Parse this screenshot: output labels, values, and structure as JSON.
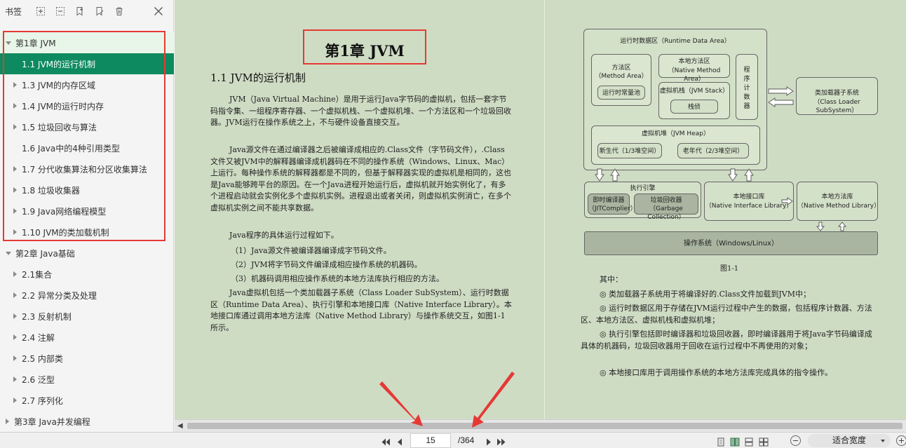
{
  "sidebar": {
    "title": "书签",
    "toolbar_icons": [
      "expand-all-icon",
      "collapse-all-icon",
      "add-bookmark-icon",
      "bookmark-edit-icon",
      "delete-icon"
    ],
    "items": [
      {
        "label": "第1章 JVM",
        "level": 0,
        "arrow": "down",
        "state": "chapter-active"
      },
      {
        "label": "1.1 JVM的运行机制",
        "level": 1,
        "arrow": "none",
        "state": "selected"
      },
      {
        "label": "1.3 JVM的内存区域",
        "level": 1,
        "arrow": "right",
        "state": ""
      },
      {
        "label": "1.4 JVM的运行时内存",
        "level": 1,
        "arrow": "right",
        "state": ""
      },
      {
        "label": "1.5 垃圾回收与算法",
        "level": 1,
        "arrow": "right",
        "state": ""
      },
      {
        "label": "1.6 Java中的4种引用类型",
        "level": 1,
        "arrow": "none",
        "state": ""
      },
      {
        "label": "1.7 分代收集算法和分区收集算法",
        "level": 1,
        "arrow": "right",
        "state": ""
      },
      {
        "label": "1.8 垃圾收集器",
        "level": 1,
        "arrow": "right",
        "state": ""
      },
      {
        "label": "1.9 Java网络编程模型",
        "level": 1,
        "arrow": "right",
        "state": ""
      },
      {
        "label": "1.10 JVM的类加载机制",
        "level": 1,
        "arrow": "right",
        "state": ""
      },
      {
        "label": "第2章 Java基础",
        "level": 0,
        "arrow": "down",
        "state": ""
      },
      {
        "label": "2.1集合",
        "level": 1,
        "arrow": "right",
        "state": ""
      },
      {
        "label": "2.2 异常分类及处理",
        "level": 1,
        "arrow": "right",
        "state": ""
      },
      {
        "label": "2.3 反射机制",
        "level": 1,
        "arrow": "right",
        "state": ""
      },
      {
        "label": "2.4 注解",
        "level": 1,
        "arrow": "right",
        "state": ""
      },
      {
        "label": "2.5 内部类",
        "level": 1,
        "arrow": "right",
        "state": ""
      },
      {
        "label": "2.6 泛型",
        "level": 1,
        "arrow": "right",
        "state": ""
      },
      {
        "label": "2.7 序列化",
        "level": 1,
        "arrow": "right",
        "state": ""
      },
      {
        "label": "第3章 Java并发编程",
        "level": 0,
        "arrow": "right",
        "state": ""
      }
    ]
  },
  "document": {
    "chapter_title": "第1章 JVM",
    "section_title": "1.1 JVM的运行机制",
    "p1": "JVM（Java Virtual Machine）是用于运行Java字节码的虚拟机，包括一套字节码指令集、一组程序寄存器、一个虚拟机栈、一个虚拟机堆、一个方法区和一个垃圾回收器。JVM运行在操作系统之上，不与硬件设备直接交互。",
    "p2": "Java源文件在通过编译器之后被编译成相应的.Class文件（字节码文件），.Class文件又被JVM中的解释器编译成机器码在不同的操作系统（Windows、Linux、Mac）上运行。每种操作系统的解释器都是不同的，但基于解释器实现的虚拟机是相同的，这也是Java能够跨平台的原因。在一个Java进程开始运行后，虚拟机就开始实例化了，有多个进程启动就会实例化多个虚拟机实例。进程退出或者关闭，则虚拟机实例消亡，在多个虚拟机实例之间不能共享数据。",
    "p3": "Java程序的具体运行过程如下。",
    "step1": "（1）Java源文件被编译器编译成字节码文件。",
    "step2": "（2）JVM将字节码文件编译成相应操作系统的机器码。",
    "step3": "（3）机器码调用相应操作系统的本地方法库执行相应的方法。",
    "p4": "Java虚拟机包括一个类加载器子系统（Class Loader SubSystem）、运行时数据区（Runtime Data Area）、执行引擎和本地接口库（Native Interface Library）。本地接口库通过调用本地方法库（Native Method Library）与操作系统交互，如图1-1所示。"
  },
  "diagram": {
    "runtime_area": "运行时数据区（Runtime Data Area）",
    "method_area": "方法区",
    "method_area_en": "（Method Area）",
    "const_pool": "运行时常量池",
    "native_stack": "本地方法区",
    "native_stack_en": "（Native Method Area）",
    "vm_stack": "虚拟机栈（JVM Stack）",
    "frame": "栈侦",
    "pc": [
      "程",
      "序",
      "计",
      "数",
      "器"
    ],
    "heap": "虚拟机堆（JVM Heap）",
    "young": "新生代（1/3堆空间）",
    "old": "老年代（2/3堆空间）",
    "class_loader": "类加载器子系统",
    "class_loader_en": "（Class Loader SubSystem）",
    "exec_engine": "执行引擎",
    "jit": "即时编译器",
    "jit_en": "（JITComplier）",
    "gc": "垃圾回收器",
    "gc_en": "（Garbage Collection）",
    "native_if": "本地接口库",
    "native_if_en": "（Native Interface Library）",
    "native_lib": "本地方法库",
    "native_lib_en": "（Native Method Library）",
    "os": "操作系统（Windows/Linux）",
    "caption": "图1-1"
  },
  "right_text": {
    "intro": "其中：",
    "b1": "◎  类加载器子系统用于将编译好的.Class文件加载到JVM中；",
    "b2": "◎  运行时数据区用于存储在JVM运行过程中产生的数据，包括程序计数器、方法区、本地方法区、虚拟机栈和虚拟机堆；",
    "b3": "◎  执行引擎包括即时编译器和垃圾回收器，即时编译器用于将Java字节码编译成具体的机器码，垃圾回收器用于回收在运行过程中不再使用的对象；",
    "b4": "◎  本地接口库用于调用操作系统的本地方法库完成具体的指令操作。"
  },
  "statusbar": {
    "page_current": "15",
    "page_total": "/364",
    "zoom": "适合宽度"
  },
  "colors": {
    "selected_bg": "#0d8a5f",
    "doc_bg": "#cfdcc4",
    "annotation_red": "#e53935"
  }
}
